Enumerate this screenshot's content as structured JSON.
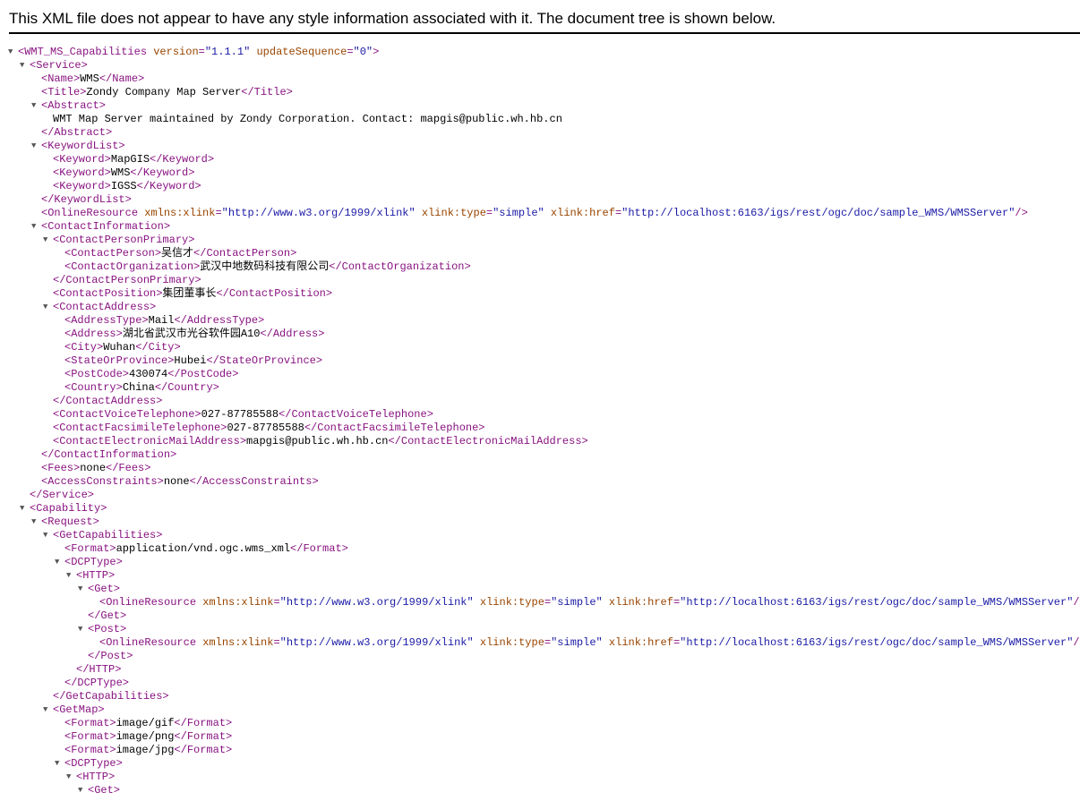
{
  "header": {
    "message": "This XML file does not appear to have any style information associated with it. The document tree is shown below."
  },
  "toggle_glyph": "▼",
  "colors": {
    "tag": "#881280",
    "attr_name": "#994500",
    "attr_value": "#1a1aa6",
    "text": "#000000"
  },
  "lines": [
    {
      "d": 0,
      "t": true,
      "s": [
        [
          "tag",
          "<WMT_MS_Capabilities "
        ],
        [
          "attr-name",
          "version"
        ],
        [
          "tag",
          "="
        ],
        [
          "attr-value",
          "\"1.1.1\""
        ],
        [
          "tag",
          " "
        ],
        [
          "attr-name",
          "updateSequence"
        ],
        [
          "tag",
          "="
        ],
        [
          "attr-value",
          "\"0\""
        ],
        [
          "tag",
          ">"
        ]
      ]
    },
    {
      "d": 1,
      "t": true,
      "s": [
        [
          "tag",
          "<Service>"
        ]
      ]
    },
    {
      "d": 2,
      "t": false,
      "s": [
        [
          "tag",
          "<Name>"
        ],
        [
          "text",
          "WMS"
        ],
        [
          "tag",
          "</Name>"
        ]
      ]
    },
    {
      "d": 2,
      "t": false,
      "s": [
        [
          "tag",
          "<Title>"
        ],
        [
          "text",
          "Zondy Company Map Server"
        ],
        [
          "tag",
          "</Title>"
        ]
      ]
    },
    {
      "d": 2,
      "t": true,
      "s": [
        [
          "tag",
          "<Abstract>"
        ]
      ]
    },
    {
      "d": 3,
      "t": false,
      "s": [
        [
          "text",
          "WMT Map Server maintained by Zondy Corporation. Contact: mapgis@public.wh.hb.cn"
        ]
      ]
    },
    {
      "d": 2,
      "t": false,
      "s": [
        [
          "tag",
          "</Abstract>"
        ]
      ]
    },
    {
      "d": 2,
      "t": true,
      "s": [
        [
          "tag",
          "<KeywordList>"
        ]
      ]
    },
    {
      "d": 3,
      "t": false,
      "s": [
        [
          "tag",
          "<Keyword>"
        ],
        [
          "text",
          "MapGIS"
        ],
        [
          "tag",
          "</Keyword>"
        ]
      ]
    },
    {
      "d": 3,
      "t": false,
      "s": [
        [
          "tag",
          "<Keyword>"
        ],
        [
          "text",
          "WMS"
        ],
        [
          "tag",
          "</Keyword>"
        ]
      ]
    },
    {
      "d": 3,
      "t": false,
      "s": [
        [
          "tag",
          "<Keyword>"
        ],
        [
          "text",
          "IGSS"
        ],
        [
          "tag",
          "</Keyword>"
        ]
      ]
    },
    {
      "d": 2,
      "t": false,
      "s": [
        [
          "tag",
          "</KeywordList>"
        ]
      ]
    },
    {
      "d": 2,
      "t": false,
      "s": [
        [
          "tag",
          "<OnlineResource "
        ],
        [
          "attr-name",
          "xmlns:xlink"
        ],
        [
          "tag",
          "="
        ],
        [
          "attr-value",
          "\"http://www.w3.org/1999/xlink\""
        ],
        [
          "tag",
          " "
        ],
        [
          "attr-name",
          "xlink:type"
        ],
        [
          "tag",
          "="
        ],
        [
          "attr-value",
          "\"simple\""
        ],
        [
          "tag",
          " "
        ],
        [
          "attr-name",
          "xlink:href"
        ],
        [
          "tag",
          "="
        ],
        [
          "attr-value",
          "\"http://localhost:6163/igs/rest/ogc/doc/sample_WMS/WMSServer\""
        ],
        [
          "tag",
          "/>"
        ]
      ]
    },
    {
      "d": 2,
      "t": true,
      "s": [
        [
          "tag",
          "<ContactInformation>"
        ]
      ]
    },
    {
      "d": 3,
      "t": true,
      "s": [
        [
          "tag",
          "<ContactPersonPrimary>"
        ]
      ]
    },
    {
      "d": 4,
      "t": false,
      "s": [
        [
          "tag",
          "<ContactPerson>"
        ],
        [
          "text",
          "吴信才"
        ],
        [
          "tag",
          "</ContactPerson>"
        ]
      ]
    },
    {
      "d": 4,
      "t": false,
      "s": [
        [
          "tag",
          "<ContactOrganization>"
        ],
        [
          "text",
          "武汉中地数码科技有限公司"
        ],
        [
          "tag",
          "</ContactOrganization>"
        ]
      ]
    },
    {
      "d": 3,
      "t": false,
      "s": [
        [
          "tag",
          "</ContactPersonPrimary>"
        ]
      ]
    },
    {
      "d": 3,
      "t": false,
      "s": [
        [
          "tag",
          "<ContactPosition>"
        ],
        [
          "text",
          "集团董事长"
        ],
        [
          "tag",
          "</ContactPosition>"
        ]
      ]
    },
    {
      "d": 3,
      "t": true,
      "s": [
        [
          "tag",
          "<ContactAddress>"
        ]
      ]
    },
    {
      "d": 4,
      "t": false,
      "s": [
        [
          "tag",
          "<AddressType>"
        ],
        [
          "text",
          "Mail"
        ],
        [
          "tag",
          "</AddressType>"
        ]
      ]
    },
    {
      "d": 4,
      "t": false,
      "s": [
        [
          "tag",
          "<Address>"
        ],
        [
          "text",
          "湖北省武汉市光谷软件园A10"
        ],
        [
          "tag",
          "</Address>"
        ]
      ]
    },
    {
      "d": 4,
      "t": false,
      "s": [
        [
          "tag",
          "<City>"
        ],
        [
          "text",
          "Wuhan"
        ],
        [
          "tag",
          "</City>"
        ]
      ]
    },
    {
      "d": 4,
      "t": false,
      "s": [
        [
          "tag",
          "<StateOrProvince>"
        ],
        [
          "text",
          "Hubei"
        ],
        [
          "tag",
          "</StateOrProvince>"
        ]
      ]
    },
    {
      "d": 4,
      "t": false,
      "s": [
        [
          "tag",
          "<PostCode>"
        ],
        [
          "text",
          "430074"
        ],
        [
          "tag",
          "</PostCode>"
        ]
      ]
    },
    {
      "d": 4,
      "t": false,
      "s": [
        [
          "tag",
          "<Country>"
        ],
        [
          "text",
          "China"
        ],
        [
          "tag",
          "</Country>"
        ]
      ]
    },
    {
      "d": 3,
      "t": false,
      "s": [
        [
          "tag",
          "</ContactAddress>"
        ]
      ]
    },
    {
      "d": 3,
      "t": false,
      "s": [
        [
          "tag",
          "<ContactVoiceTelephone>"
        ],
        [
          "text",
          "027-87785588"
        ],
        [
          "tag",
          "</ContactVoiceTelephone>"
        ]
      ]
    },
    {
      "d": 3,
      "t": false,
      "s": [
        [
          "tag",
          "<ContactFacsimileTelephone>"
        ],
        [
          "text",
          "027-87785588"
        ],
        [
          "tag",
          "</ContactFacsimileTelephone>"
        ]
      ]
    },
    {
      "d": 3,
      "t": false,
      "s": [
        [
          "tag",
          "<ContactElectronicMailAddress>"
        ],
        [
          "text",
          "mapgis@public.wh.hb.cn"
        ],
        [
          "tag",
          "</ContactElectronicMailAddress>"
        ]
      ]
    },
    {
      "d": 2,
      "t": false,
      "s": [
        [
          "tag",
          "</ContactInformation>"
        ]
      ]
    },
    {
      "d": 2,
      "t": false,
      "s": [
        [
          "tag",
          "<Fees>"
        ],
        [
          "text",
          "none"
        ],
        [
          "tag",
          "</Fees>"
        ]
      ]
    },
    {
      "d": 2,
      "t": false,
      "s": [
        [
          "tag",
          "<AccessConstraints>"
        ],
        [
          "text",
          "none"
        ],
        [
          "tag",
          "</AccessConstraints>"
        ]
      ]
    },
    {
      "d": 1,
      "t": false,
      "s": [
        [
          "tag",
          "</Service>"
        ]
      ]
    },
    {
      "d": 1,
      "t": true,
      "s": [
        [
          "tag",
          "<Capability>"
        ]
      ]
    },
    {
      "d": 2,
      "t": true,
      "s": [
        [
          "tag",
          "<Request>"
        ]
      ]
    },
    {
      "d": 3,
      "t": true,
      "s": [
        [
          "tag",
          "<GetCapabilities>"
        ]
      ]
    },
    {
      "d": 4,
      "t": false,
      "s": [
        [
          "tag",
          "<Format>"
        ],
        [
          "text",
          "application/vnd.ogc.wms_xml"
        ],
        [
          "tag",
          "</Format>"
        ]
      ]
    },
    {
      "d": 4,
      "t": true,
      "s": [
        [
          "tag",
          "<DCPType>"
        ]
      ]
    },
    {
      "d": 5,
      "t": true,
      "s": [
        [
          "tag",
          "<HTTP>"
        ]
      ]
    },
    {
      "d": 6,
      "t": true,
      "s": [
        [
          "tag",
          "<Get>"
        ]
      ]
    },
    {
      "d": 7,
      "t": false,
      "s": [
        [
          "tag",
          "<OnlineResource "
        ],
        [
          "attr-name",
          "xmlns:xlink"
        ],
        [
          "tag",
          "="
        ],
        [
          "attr-value",
          "\"http://www.w3.org/1999/xlink\""
        ],
        [
          "tag",
          " "
        ],
        [
          "attr-name",
          "xlink:type"
        ],
        [
          "tag",
          "="
        ],
        [
          "attr-value",
          "\"simple\""
        ],
        [
          "tag",
          " "
        ],
        [
          "attr-name",
          "xlink:href"
        ],
        [
          "tag",
          "="
        ],
        [
          "attr-value",
          "\"http://localhost:6163/igs/rest/ogc/doc/sample_WMS/WMSServer\""
        ],
        [
          "tag",
          "/>"
        ]
      ]
    },
    {
      "d": 6,
      "t": false,
      "s": [
        [
          "tag",
          "</Get>"
        ]
      ]
    },
    {
      "d": 6,
      "t": true,
      "s": [
        [
          "tag",
          "<Post>"
        ]
      ]
    },
    {
      "d": 7,
      "t": false,
      "s": [
        [
          "tag",
          "<OnlineResource "
        ],
        [
          "attr-name",
          "xmlns:xlink"
        ],
        [
          "tag",
          "="
        ],
        [
          "attr-value",
          "\"http://www.w3.org/1999/xlink\""
        ],
        [
          "tag",
          " "
        ],
        [
          "attr-name",
          "xlink:type"
        ],
        [
          "tag",
          "="
        ],
        [
          "attr-value",
          "\"simple\""
        ],
        [
          "tag",
          " "
        ],
        [
          "attr-name",
          "xlink:href"
        ],
        [
          "tag",
          "="
        ],
        [
          "attr-value",
          "\"http://localhost:6163/igs/rest/ogc/doc/sample_WMS/WMSServer\""
        ],
        [
          "tag",
          "/>"
        ]
      ]
    },
    {
      "d": 6,
      "t": false,
      "s": [
        [
          "tag",
          "</Post>"
        ]
      ]
    },
    {
      "d": 5,
      "t": false,
      "s": [
        [
          "tag",
          "</HTTP>"
        ]
      ]
    },
    {
      "d": 4,
      "t": false,
      "s": [
        [
          "tag",
          "</DCPType>"
        ]
      ]
    },
    {
      "d": 3,
      "t": false,
      "s": [
        [
          "tag",
          "</GetCapabilities>"
        ]
      ]
    },
    {
      "d": 3,
      "t": true,
      "s": [
        [
          "tag",
          "<GetMap>"
        ]
      ]
    },
    {
      "d": 4,
      "t": false,
      "s": [
        [
          "tag",
          "<Format>"
        ],
        [
          "text",
          "image/gif"
        ],
        [
          "tag",
          "</Format>"
        ]
      ]
    },
    {
      "d": 4,
      "t": false,
      "s": [
        [
          "tag",
          "<Format>"
        ],
        [
          "text",
          "image/png"
        ],
        [
          "tag",
          "</Format>"
        ]
      ]
    },
    {
      "d": 4,
      "t": false,
      "s": [
        [
          "tag",
          "<Format>"
        ],
        [
          "text",
          "image/jpg"
        ],
        [
          "tag",
          "</Format>"
        ]
      ]
    },
    {
      "d": 4,
      "t": true,
      "s": [
        [
          "tag",
          "<DCPType>"
        ]
      ]
    },
    {
      "d": 5,
      "t": true,
      "s": [
        [
          "tag",
          "<HTTP>"
        ]
      ]
    },
    {
      "d": 6,
      "t": true,
      "s": [
        [
          "tag",
          "<Get>"
        ]
      ]
    }
  ]
}
